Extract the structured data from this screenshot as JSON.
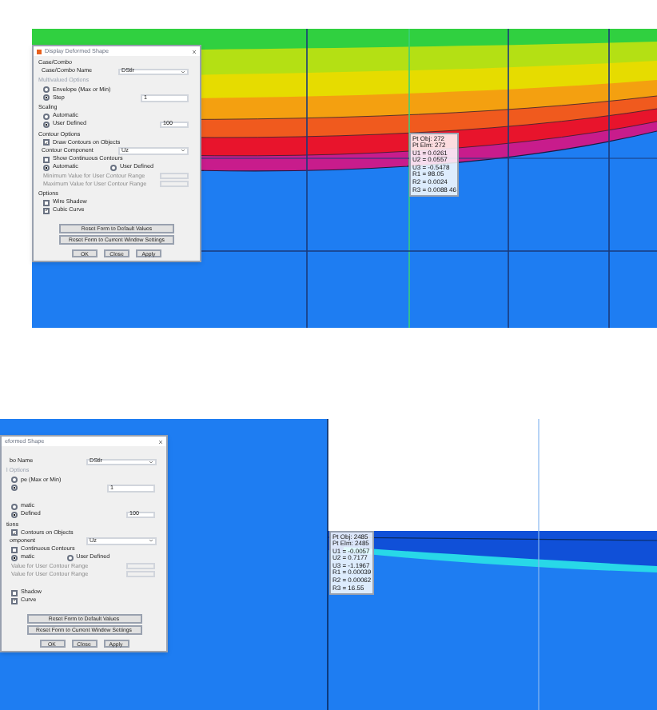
{
  "panels": [
    {
      "dialog": {
        "title": "Display Deformed Shape",
        "rows": [
          {
            "kind": "heading",
            "label": "Case/Combo"
          },
          {
            "kind": "select",
            "label": "Case/Combo Name",
            "value": "DStlr"
          },
          {
            "kind": "heading",
            "label": "Multivalued Options",
            "disabled": true
          },
          {
            "kind": "radio",
            "label": "Envelope (Max or Min)",
            "selected": false
          },
          {
            "kind": "spinner",
            "label": "Step",
            "selected": true,
            "value": "1"
          },
          {
            "kind": "heading",
            "label": "Scaling"
          },
          {
            "kind": "radio",
            "label": "Automatic",
            "selected": false
          },
          {
            "kind": "input",
            "label": "User Defined",
            "selected": true,
            "value": "100"
          },
          {
            "kind": "heading",
            "label": "Contour Options"
          },
          {
            "kind": "checkbox",
            "label": "Draw Contours on Objects",
            "checked": true
          },
          {
            "kind": "select",
            "label": "Contour Component",
            "value": "Uz"
          },
          {
            "kind": "checkbox",
            "label": "Show Continuous Contours",
            "checked": false
          },
          {
            "kind": "radiopair",
            "items": [
              {
                "label": "Automatic",
                "selected": true
              },
              {
                "label": "User Defined",
                "selected": false
              }
            ]
          },
          {
            "kind": "input",
            "label": "Minimum Value for User Contour Range",
            "disabled": true
          },
          {
            "kind": "input",
            "label": "Maximum Value for User Contour Range",
            "disabled": true
          },
          {
            "kind": "heading",
            "label": "Options"
          },
          {
            "kind": "checkbox",
            "label": "Wire Shadow",
            "checked": false
          },
          {
            "kind": "checkbox",
            "label": "Cubic Curve",
            "checked": true
          }
        ],
        "buttons": [
          "Reset Form to Default Values",
          "Reset Form to Current Window Settings"
        ],
        "actions": [
          "OK",
          "Close",
          "Apply"
        ]
      },
      "tooltip": [
        "Pt Obj: 272",
        "Pt Elm: 272",
        "U1 = 0.0261",
        "U2 = 0.0557",
        "U3 = -0.5478",
        "R1 = 98.05",
        "R2 = 0.0024",
        "R3 = 0.0088 46"
      ]
    },
    {
      "dialog": {
        "title": "eformed Shape",
        "rows": [
          {
            "kind": "heading",
            "label": ""
          },
          {
            "kind": "select",
            "label": "bo Name",
            "value": "DStlr"
          },
          {
            "kind": "heading",
            "label": "l Options",
            "disabled": true
          },
          {
            "kind": "radio",
            "label": "pe (Max or Min)",
            "selected": false
          },
          {
            "kind": "spinner",
            "label": "",
            "selected": true,
            "value": "1"
          },
          {
            "kind": "heading",
            "label": ""
          },
          {
            "kind": "radio",
            "label": "matic",
            "selected": false
          },
          {
            "kind": "input",
            "label": "Defined",
            "selected": true,
            "value": "100"
          },
          {
            "kind": "heading",
            "label": "tions"
          },
          {
            "kind": "checkbox",
            "label": "Contours on Objects",
            "checked": true
          },
          {
            "kind": "select",
            "label": "omponent",
            "value": "Uz"
          },
          {
            "kind": "checkbox",
            "label": "Continuous Contours",
            "checked": false
          },
          {
            "kind": "radiopair",
            "items": [
              {
                "label": "matic",
                "selected": true
              },
              {
                "label": "User Defined",
                "selected": false
              }
            ]
          },
          {
            "kind": "input",
            "label": "Value for User Contour Range",
            "disabled": true
          },
          {
            "kind": "input",
            "label": "Value for User Contour Range",
            "disabled": true
          },
          {
            "kind": "heading",
            "label": ""
          },
          {
            "kind": "checkbox",
            "label": "Shadow",
            "checked": false
          },
          {
            "kind": "checkbox",
            "label": "Curve",
            "checked": true
          }
        ],
        "buttons": [
          "Reset Form to Default Values",
          "Reset Form to Current Window Settings"
        ],
        "actions": [
          "OK",
          "Close",
          "Apply"
        ]
      },
      "tooltip": [
        "Pt Obj: 2485",
        "Pt Elm: 2485",
        "U1 = -0.0057",
        "U2 = 0.7177",
        "U3 = -1.1967",
        "R1 = 0.00039",
        "R2 = 0.00062",
        "R3 = 16.55"
      ]
    }
  ]
}
